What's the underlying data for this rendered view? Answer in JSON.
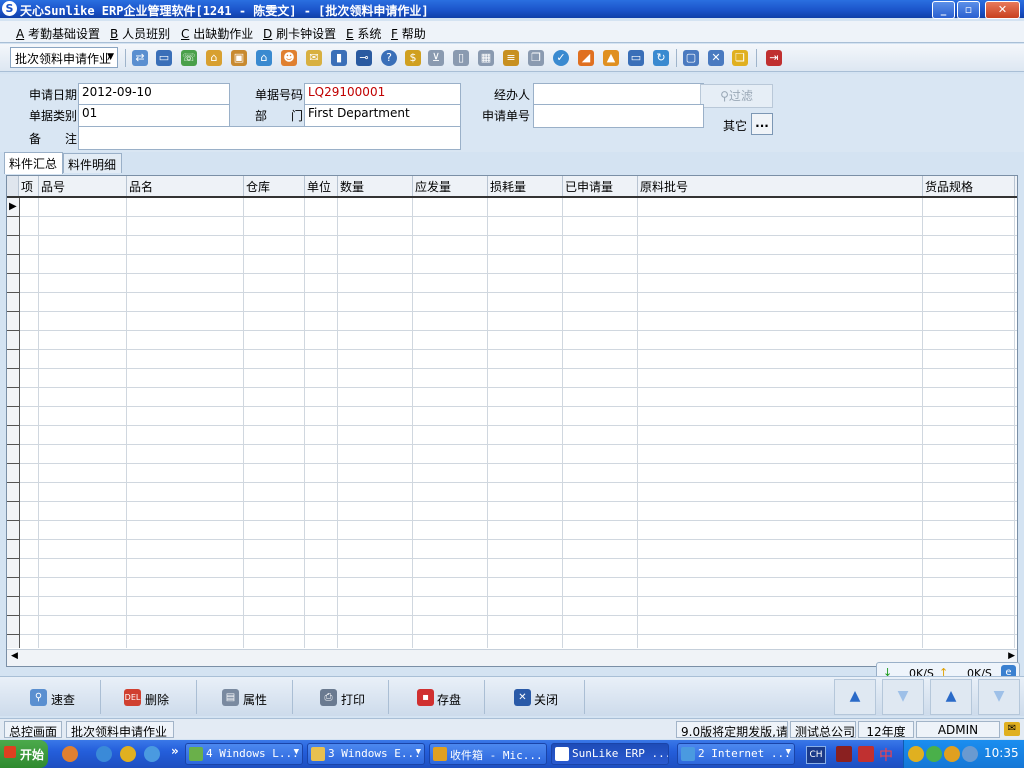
{
  "window": {
    "title": "天心Sunlike ERP企业管理软件[1241 - 陈雯文] - [批次领料申请作业]"
  },
  "menu": [
    {
      "key": "A",
      "label": "考勤基础设置"
    },
    {
      "key": "B",
      "label": "人员班别"
    },
    {
      "key": "C",
      "label": "出缺勤作业"
    },
    {
      "key": "D",
      "label": "刷卡钟设置"
    },
    {
      "key": "E",
      "label": "系统"
    },
    {
      "key": "F",
      "label": "帮助"
    }
  ],
  "toolbar": {
    "program_select": "批次领料申请作业"
  },
  "form": {
    "apply_date_label": "申请日期",
    "apply_date": "2012-09-10",
    "doc_no_label": "单据号码",
    "doc_no": "LQ29100001",
    "handler_label": "经办人",
    "handler": "",
    "doc_type_label": "单据类别",
    "doc_type": "01",
    "dept_label": "部　　门",
    "dept": "First Department",
    "apply_no_label": "申请单号",
    "apply_no": "",
    "remark_label": "备　　注",
    "remark": "",
    "filter_label": "过滤",
    "other_label": "其它",
    "other_btn": "..."
  },
  "tabs": [
    {
      "label": "料件汇总",
      "active": true
    },
    {
      "label": "料件明细",
      "active": false
    }
  ],
  "grid": {
    "columns": [
      "项",
      "品号",
      "品名",
      "仓库",
      "单位",
      "数量",
      "应发量",
      "损耗量",
      "已申请量",
      "原料批号",
      "货品规格"
    ],
    "rows": []
  },
  "actions": {
    "quick_search": "速查",
    "delete": "删除",
    "properties": "属性",
    "print": "打印",
    "save": "存盘",
    "close": "关闭"
  },
  "net": {
    "down": "0K/S",
    "up": "0K/S"
  },
  "status": {
    "home": "总控画面",
    "current": "批次领料申请作业",
    "notice": "9.0版将定期发版,请",
    "company": "测试总公司",
    "year": "12年度",
    "user": "ADMIN"
  },
  "taskbar": {
    "start": "开始",
    "more": "»",
    "tasks": [
      {
        "label": "4 Windows L...",
        "active": false
      },
      {
        "label": "3 Windows E...",
        "active": false
      },
      {
        "label": "收件箱 - Mic...",
        "active": false
      },
      {
        "label": "SunLike ERP ...",
        "active": true
      },
      {
        "label": "2 Internet ...",
        "active": false
      }
    ],
    "lang": "CH",
    "ime": "中",
    "clock": "10:35"
  },
  "colors": {
    "title_bar": "#1a52c8",
    "form_bg": "#d9e6f3",
    "doc_no_text": "#c00000"
  }
}
